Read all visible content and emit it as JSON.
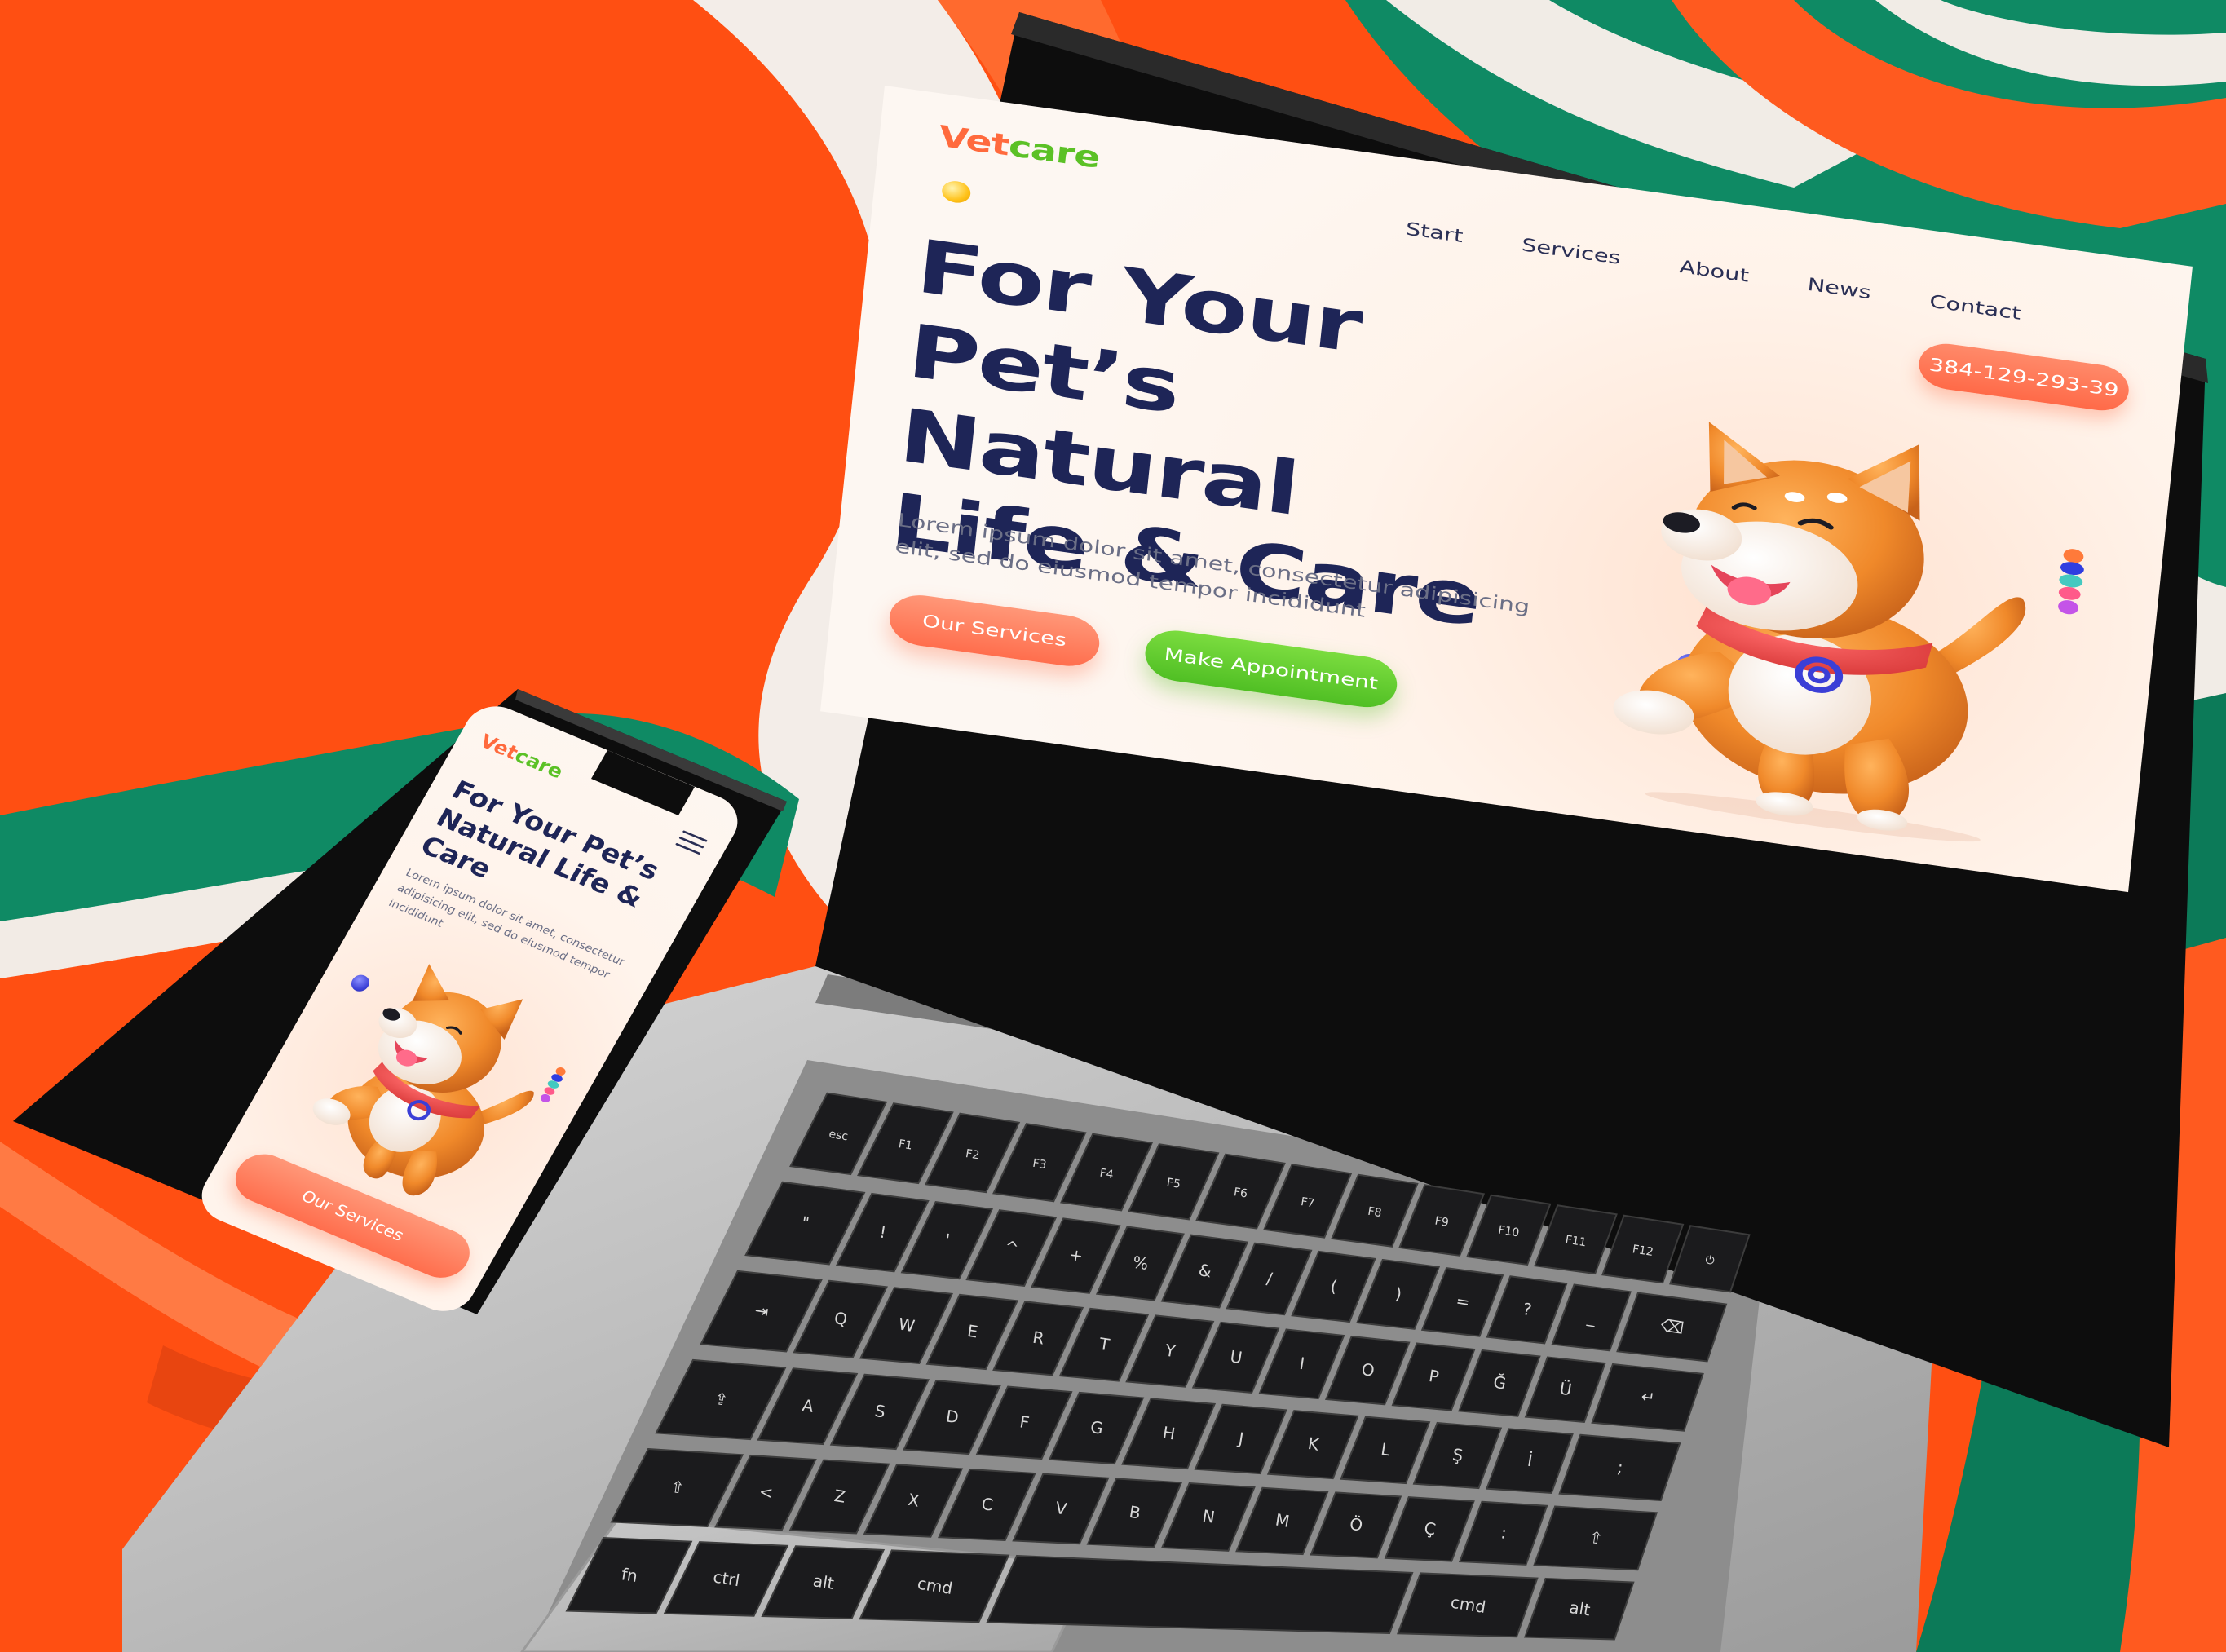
{
  "desktop": {
    "logo": {
      "vet": "Vet",
      "care": "care"
    },
    "nav": [
      "Start",
      "Services",
      "About",
      "News",
      "Contact"
    ],
    "phone_number": "384-129-293-39",
    "hero": {
      "title_lines": [
        "For Your",
        "Pet’s Natural",
        "Life & Care"
      ],
      "description": "Lorem ipsum dolor sit amet, consectetur adipisicing elit, sed do eiusmod tempor incididunt"
    },
    "buttons": {
      "services": "Our Services",
      "appointment": "Make Appointment"
    }
  },
  "mobile": {
    "logo": {
      "vet": "Vet",
      "care": "care"
    },
    "hero": {
      "title_lines": [
        "For Your Pet’s",
        "Natural Life &",
        "Care"
      ],
      "description": "Lorem ipsum dolor sit amet, consectetur adipisicing elit, sed do eiusmod tempor incididunt"
    },
    "button": "Our Services"
  },
  "keyboard": {
    "rows": [
      [
        "esc",
        "F1",
        "F2",
        "F3",
        "F4",
        "F5",
        "F6",
        "F7",
        "F8",
        "F9",
        "F10",
        "F11",
        "F12",
        "⏻"
      ],
      [
        "\"",
        "!",
        "'",
        "^",
        "+",
        "%",
        "&",
        "/",
        "(",
        ")",
        "=",
        "?",
        "_",
        "⌫"
      ],
      [
        "⇥",
        "Q",
        "W",
        "E",
        "R",
        "T",
        "Y",
        "U",
        "I",
        "O",
        "P",
        "Ğ",
        "Ü",
        "↵"
      ],
      [
        "⇪",
        "A",
        "S",
        "D",
        "F",
        "G",
        "H",
        "J",
        "K",
        "L",
        "Ş",
        "İ",
        ";"
      ],
      [
        "⇧",
        "<",
        "Z",
        "X",
        "C",
        "V",
        "B",
        "N",
        "M",
        "Ö",
        "Ç",
        ":",
        "⇧"
      ],
      [
        "fn",
        "ctrl",
        "alt",
        "cmd",
        "",
        "cmd",
        "alt"
      ]
    ]
  },
  "colors": {
    "background_orange": "#ff4f12",
    "background_green": "#0f8a64",
    "accent_orange": "#ff6e4d",
    "accent_green": "#5bc126",
    "heading_navy": "#1e2557"
  }
}
